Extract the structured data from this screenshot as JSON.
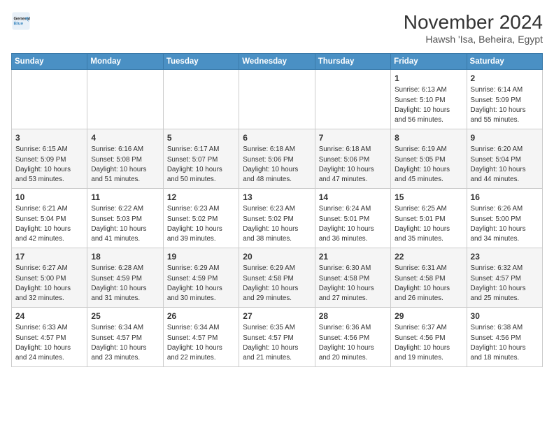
{
  "header": {
    "logo_line1": "General",
    "logo_line2": "Blue",
    "month": "November 2024",
    "location": "Hawsh 'Isa, Beheira, Egypt"
  },
  "weekdays": [
    "Sunday",
    "Monday",
    "Tuesday",
    "Wednesday",
    "Thursday",
    "Friday",
    "Saturday"
  ],
  "weeks": [
    [
      {
        "day": "",
        "info": ""
      },
      {
        "day": "",
        "info": ""
      },
      {
        "day": "",
        "info": ""
      },
      {
        "day": "",
        "info": ""
      },
      {
        "day": "",
        "info": ""
      },
      {
        "day": "1",
        "info": "Sunrise: 6:13 AM\nSunset: 5:10 PM\nDaylight: 10 hours and 56 minutes."
      },
      {
        "day": "2",
        "info": "Sunrise: 6:14 AM\nSunset: 5:09 PM\nDaylight: 10 hours and 55 minutes."
      }
    ],
    [
      {
        "day": "3",
        "info": "Sunrise: 6:15 AM\nSunset: 5:09 PM\nDaylight: 10 hours and 53 minutes."
      },
      {
        "day": "4",
        "info": "Sunrise: 6:16 AM\nSunset: 5:08 PM\nDaylight: 10 hours and 51 minutes."
      },
      {
        "day": "5",
        "info": "Sunrise: 6:17 AM\nSunset: 5:07 PM\nDaylight: 10 hours and 50 minutes."
      },
      {
        "day": "6",
        "info": "Sunrise: 6:18 AM\nSunset: 5:06 PM\nDaylight: 10 hours and 48 minutes."
      },
      {
        "day": "7",
        "info": "Sunrise: 6:18 AM\nSunset: 5:06 PM\nDaylight: 10 hours and 47 minutes."
      },
      {
        "day": "8",
        "info": "Sunrise: 6:19 AM\nSunset: 5:05 PM\nDaylight: 10 hours and 45 minutes."
      },
      {
        "day": "9",
        "info": "Sunrise: 6:20 AM\nSunset: 5:04 PM\nDaylight: 10 hours and 44 minutes."
      }
    ],
    [
      {
        "day": "10",
        "info": "Sunrise: 6:21 AM\nSunset: 5:04 PM\nDaylight: 10 hours and 42 minutes."
      },
      {
        "day": "11",
        "info": "Sunrise: 6:22 AM\nSunset: 5:03 PM\nDaylight: 10 hours and 41 minutes."
      },
      {
        "day": "12",
        "info": "Sunrise: 6:23 AM\nSunset: 5:02 PM\nDaylight: 10 hours and 39 minutes."
      },
      {
        "day": "13",
        "info": "Sunrise: 6:23 AM\nSunset: 5:02 PM\nDaylight: 10 hours and 38 minutes."
      },
      {
        "day": "14",
        "info": "Sunrise: 6:24 AM\nSunset: 5:01 PM\nDaylight: 10 hours and 36 minutes."
      },
      {
        "day": "15",
        "info": "Sunrise: 6:25 AM\nSunset: 5:01 PM\nDaylight: 10 hours and 35 minutes."
      },
      {
        "day": "16",
        "info": "Sunrise: 6:26 AM\nSunset: 5:00 PM\nDaylight: 10 hours and 34 minutes."
      }
    ],
    [
      {
        "day": "17",
        "info": "Sunrise: 6:27 AM\nSunset: 5:00 PM\nDaylight: 10 hours and 32 minutes."
      },
      {
        "day": "18",
        "info": "Sunrise: 6:28 AM\nSunset: 4:59 PM\nDaylight: 10 hours and 31 minutes."
      },
      {
        "day": "19",
        "info": "Sunrise: 6:29 AM\nSunset: 4:59 PM\nDaylight: 10 hours and 30 minutes."
      },
      {
        "day": "20",
        "info": "Sunrise: 6:29 AM\nSunset: 4:58 PM\nDaylight: 10 hours and 29 minutes."
      },
      {
        "day": "21",
        "info": "Sunrise: 6:30 AM\nSunset: 4:58 PM\nDaylight: 10 hours and 27 minutes."
      },
      {
        "day": "22",
        "info": "Sunrise: 6:31 AM\nSunset: 4:58 PM\nDaylight: 10 hours and 26 minutes."
      },
      {
        "day": "23",
        "info": "Sunrise: 6:32 AM\nSunset: 4:57 PM\nDaylight: 10 hours and 25 minutes."
      }
    ],
    [
      {
        "day": "24",
        "info": "Sunrise: 6:33 AM\nSunset: 4:57 PM\nDaylight: 10 hours and 24 minutes."
      },
      {
        "day": "25",
        "info": "Sunrise: 6:34 AM\nSunset: 4:57 PM\nDaylight: 10 hours and 23 minutes."
      },
      {
        "day": "26",
        "info": "Sunrise: 6:34 AM\nSunset: 4:57 PM\nDaylight: 10 hours and 22 minutes."
      },
      {
        "day": "27",
        "info": "Sunrise: 6:35 AM\nSunset: 4:57 PM\nDaylight: 10 hours and 21 minutes."
      },
      {
        "day": "28",
        "info": "Sunrise: 6:36 AM\nSunset: 4:56 PM\nDaylight: 10 hours and 20 minutes."
      },
      {
        "day": "29",
        "info": "Sunrise: 6:37 AM\nSunset: 4:56 PM\nDaylight: 10 hours and 19 minutes."
      },
      {
        "day": "30",
        "info": "Sunrise: 6:38 AM\nSunset: 4:56 PM\nDaylight: 10 hours and 18 minutes."
      }
    ]
  ]
}
